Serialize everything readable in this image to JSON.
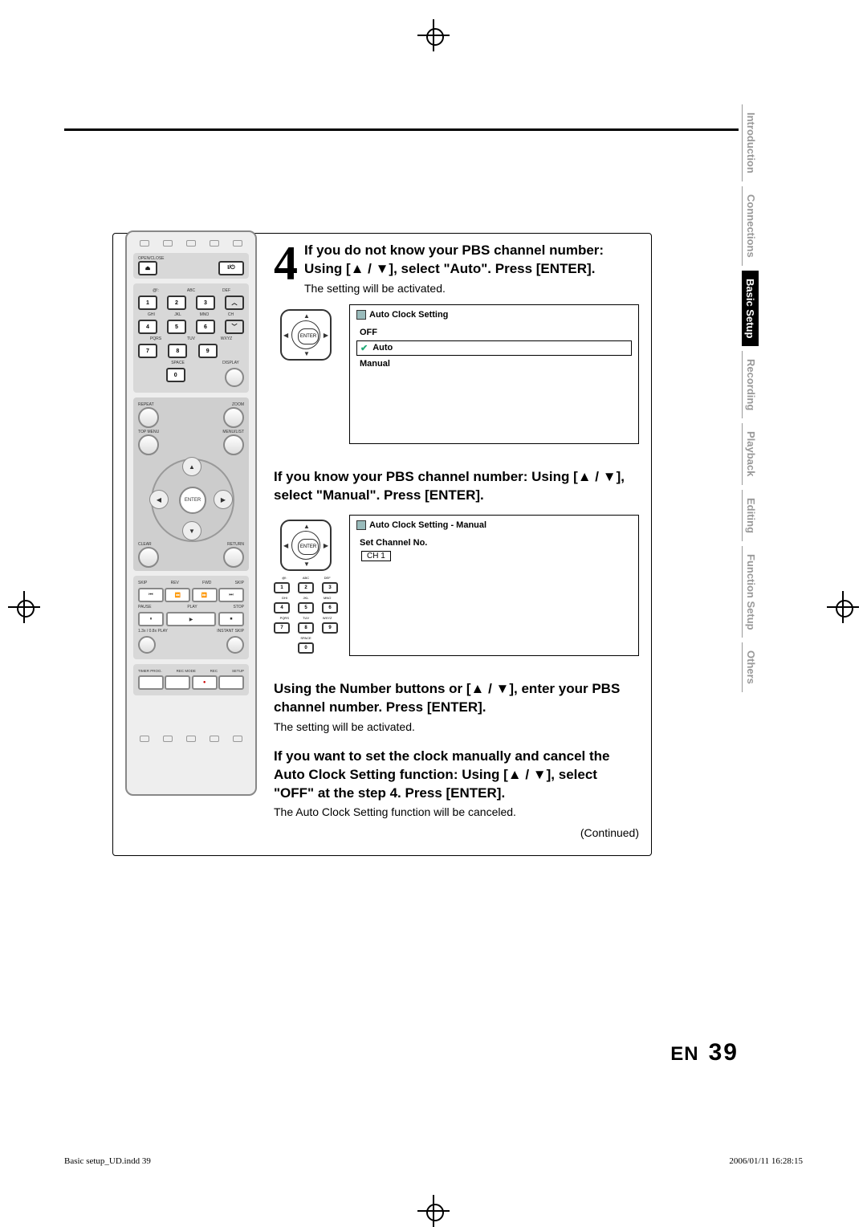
{
  "page": {
    "lang": "EN",
    "number": "39"
  },
  "footer": {
    "left": "Basic setup_UD.indd   39",
    "right": "2006/01/11   16:28:15"
  },
  "tabs": [
    "Introduction",
    "Connections",
    "Basic Setup",
    "Recording",
    "Playback",
    "Editing",
    "Function Setup",
    "Others"
  ],
  "tabs_active_index": 2,
  "step": {
    "number": "4",
    "heading_a": "If  you do not know your PBS channel number: Using [▲ / ▼], select \"Auto\". Press [ENTER].",
    "sub_a": "The setting will be activated.",
    "heading_b": "If you know your PBS channel number: Using [▲ / ▼], select \"Manual\". Press [ENTER].",
    "heading_c": "Using the Number buttons or [▲ / ▼], enter your PBS channel number. Press [ENTER].",
    "sub_c": "The setting will be activated.",
    "heading_d": "If you want to set the clock manually and cancel the Auto Clock Setting function: Using [▲ / ▼], select \"OFF\" at the step 4. Press [ENTER].",
    "sub_d": "The Auto Clock Setting function will be canceled.",
    "continued": "(Continued)"
  },
  "osd1": {
    "title": "Auto Clock Setting",
    "items": [
      {
        "label": "OFF",
        "selected": false,
        "checked": false
      },
      {
        "label": "Auto",
        "selected": true,
        "checked": true
      },
      {
        "label": "Manual",
        "selected": false,
        "checked": false
      }
    ]
  },
  "osd2": {
    "title": "Auto Clock Setting - Manual",
    "set_label": "Set Channel No.",
    "channel": "CH  1"
  },
  "remote": {
    "open_close": "OPEN/CLOSE",
    "power": "I/⏻",
    "keypad_labels_row1": [
      "@!:",
      "ABC",
      "DEF"
    ],
    "keypad_row1": [
      "1",
      "2",
      "3"
    ],
    "keypad_labels_row2": [
      "GHI",
      "JKL",
      "MNO"
    ],
    "keypad_row2": [
      "4",
      "5",
      "6"
    ],
    "keypad_labels_row3": [
      "PQRS",
      "TUV",
      "WXYZ"
    ],
    "keypad_row3": [
      "7",
      "8",
      "9"
    ],
    "space": "SPACE",
    "zero": "0",
    "ch": "CH",
    "display": "DISPLAY",
    "repeat": "REPEAT",
    "zoom": "ZOOM",
    "top_menu": "TOP MENU",
    "menu_list": "MENU/LIST",
    "enter": "ENTER",
    "clear": "CLEAR",
    "return": "RETURN",
    "transport_labels": [
      "SKIP",
      "REV",
      "FWD",
      "SKIP"
    ],
    "transport2_labels": [
      "PAUSE",
      "PLAY",
      "STOP"
    ],
    "speed": "1.3x / 0.8x PLAY",
    "instant": "INSTANT SKIP",
    "bottom_labels": [
      "TIMER PROG.",
      "REC MODE",
      "REC",
      "SETUP"
    ]
  },
  "nav": {
    "enter": "ENTER"
  }
}
